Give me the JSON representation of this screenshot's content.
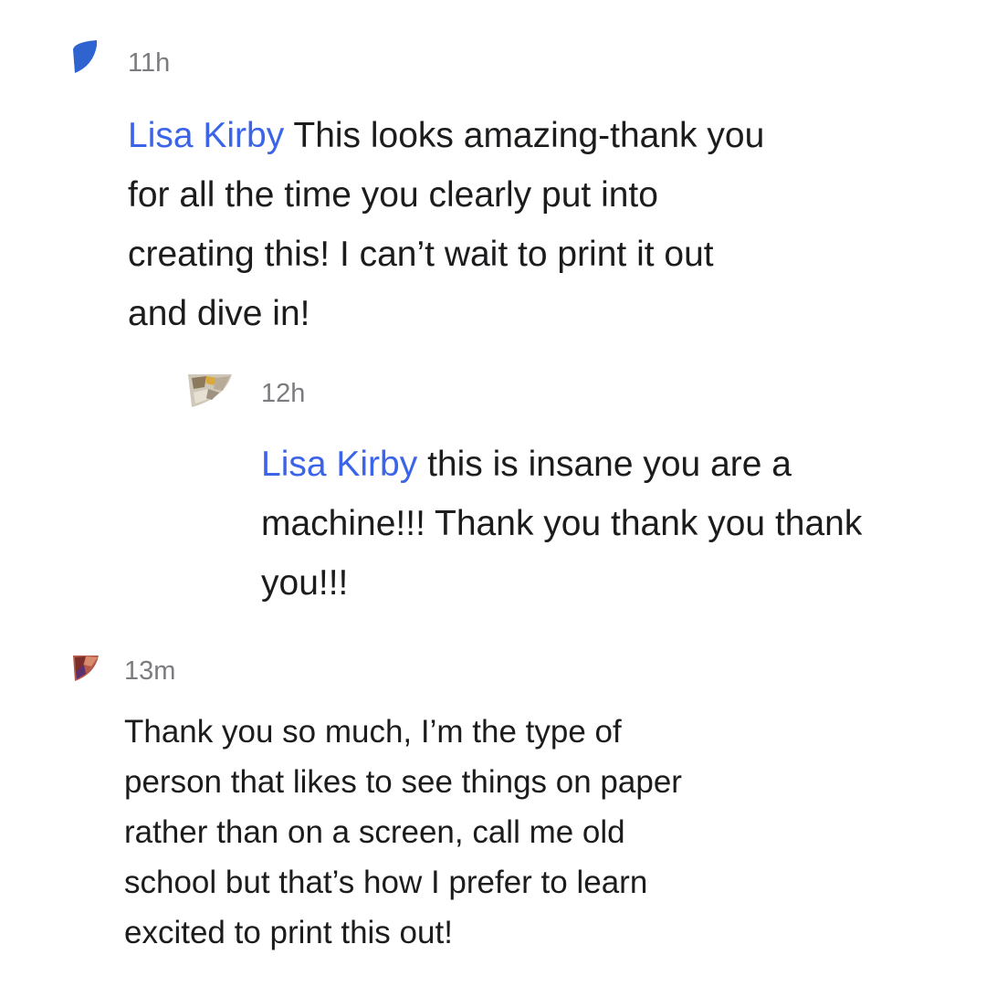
{
  "comments": [
    {
      "timestamp": "11h",
      "avatar_icon": "user-avatar-blue",
      "mention": "Lisa Kirby",
      "lines": [
        " This looks amazing-thank you",
        "for all the time you clearly put into",
        "creating this! I can’t wait to print it out",
        "and dive in!"
      ]
    },
    {
      "timestamp": "12h",
      "avatar_icon": "user-avatar-photo-outdoor",
      "mention": "Lisa Kirby",
      "lines": [
        " this is insane you are a",
        "machine!!! Thank you thank you thank",
        "you!!!"
      ]
    },
    {
      "timestamp": "13m",
      "avatar_icon": "user-avatar-photo-person",
      "lines": [
        "Thank you so much, I’m the type of",
        "person that likes to see things on paper",
        "rather than on a screen, call me old",
        "school but that’s how I prefer to learn",
        "excited to print this out!"
      ]
    }
  ],
  "colors": {
    "mention": "#3b64e8",
    "timestamp": "#7b7b80",
    "text": "#1c1c1e",
    "background": "#ffffff"
  }
}
